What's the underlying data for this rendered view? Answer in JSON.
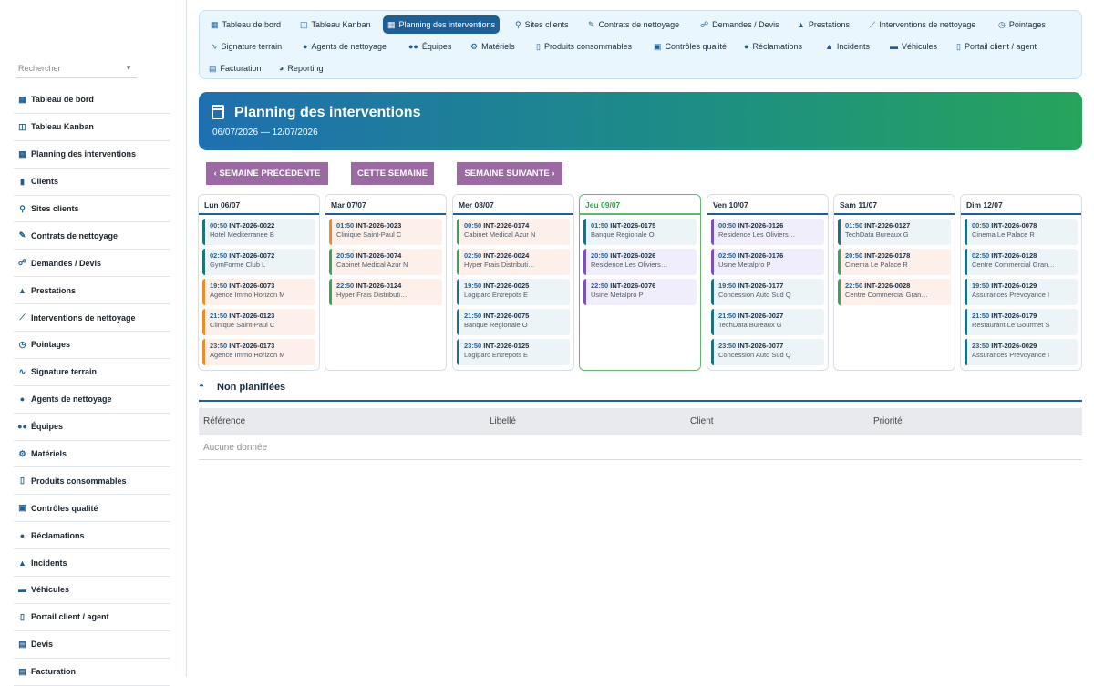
{
  "sidebar": {
    "search_placeholder": "Rechercher",
    "items": [
      {
        "icon": "grid-icon",
        "glyph": "▦",
        "label": "Tableau de bord"
      },
      {
        "icon": "kanban-icon",
        "glyph": "◫",
        "label": "Tableau Kanban"
      },
      {
        "icon": "calendar-icon",
        "glyph": "▦",
        "label": "Planning des interventions"
      },
      {
        "icon": "building-icon",
        "glyph": "▮",
        "label": "Clients"
      },
      {
        "icon": "map-pin-icon",
        "glyph": "⚲",
        "label": "Sites clients"
      },
      {
        "icon": "contract-icon",
        "glyph": "✎",
        "label": "Contrats de nettoyage"
      },
      {
        "icon": "handshake-icon",
        "glyph": "☍",
        "label": "Demandes / Devis"
      },
      {
        "icon": "service-icon",
        "glyph": "▲",
        "label": "Prestations"
      },
      {
        "icon": "broom-icon",
        "glyph": "⟋",
        "label": "Interventions de nettoyage"
      },
      {
        "icon": "clock-icon",
        "glyph": "◷",
        "label": "Pointages"
      },
      {
        "icon": "signature-icon",
        "glyph": "∿",
        "label": "Signature terrain"
      },
      {
        "icon": "user-icon",
        "glyph": "●",
        "label": "Agents de nettoyage"
      },
      {
        "icon": "team-icon",
        "glyph": "●●",
        "label": "Équipes"
      },
      {
        "icon": "cogs-icon",
        "glyph": "⚙",
        "label": "Matériels"
      },
      {
        "icon": "spray-icon",
        "glyph": "▯",
        "label": "Produits consommables"
      },
      {
        "icon": "clipboard-check-icon",
        "glyph": "▣",
        "label": "Contrôles qualité"
      },
      {
        "icon": "comment-icon",
        "glyph": "●",
        "label": "Réclamations"
      },
      {
        "icon": "warning-icon",
        "glyph": "▲",
        "label": "Incidents"
      },
      {
        "icon": "truck-icon",
        "glyph": "▬",
        "label": "Véhicules"
      },
      {
        "icon": "mobile-icon",
        "glyph": "▯",
        "label": "Portail client / agent"
      },
      {
        "icon": "file-icon",
        "glyph": "▤",
        "label": "Devis"
      },
      {
        "icon": "invoice-icon",
        "glyph": "▤",
        "label": "Facturation"
      }
    ]
  },
  "topnav": {
    "items": [
      {
        "icon": "grid-icon",
        "glyph": "▦",
        "label": "Tableau de bord",
        "active": false
      },
      {
        "icon": "kanban-icon",
        "glyph": "◫",
        "label": "Tableau Kanban",
        "active": false
      },
      {
        "icon": "calendar-icon",
        "glyph": "▦",
        "label": "Planning des interventions",
        "active": true
      },
      {
        "icon": "map-pin-icon",
        "glyph": "⚲",
        "label": "Sites clients",
        "active": false
      },
      {
        "icon": "contract-icon",
        "glyph": "✎",
        "label": "Contrats de nettoyage",
        "active": false
      },
      {
        "icon": "handshake-icon",
        "glyph": "☍",
        "label": "Demandes / Devis",
        "active": false
      },
      {
        "icon": "service-icon",
        "glyph": "▲",
        "label": "Prestations",
        "active": false
      },
      {
        "icon": "broom-icon",
        "glyph": "⟋",
        "label": "Interventions de nettoyage",
        "active": false
      },
      {
        "icon": "clock-icon",
        "glyph": "◷",
        "label": "Pointages",
        "active": false
      },
      {
        "icon": "signature-icon",
        "glyph": "∿",
        "label": "Signature terrain",
        "active": false
      },
      {
        "icon": "user-icon",
        "glyph": "●",
        "label": "Agents de nettoyage",
        "active": false
      },
      {
        "icon": "team-icon",
        "glyph": "●●",
        "label": "Équipes",
        "active": false
      },
      {
        "icon": "cogs-icon",
        "glyph": "⚙",
        "label": "Matériels",
        "active": false
      },
      {
        "icon": "spray-icon",
        "glyph": "▯",
        "label": "Produits consommables",
        "active": false
      },
      {
        "icon": "clipboard-check-icon",
        "glyph": "▣",
        "label": "Contrôles qualité",
        "active": false
      },
      {
        "icon": "comment-icon",
        "glyph": "●",
        "label": "Réclamations",
        "active": false
      },
      {
        "icon": "warning-icon",
        "glyph": "▲",
        "label": "Incidents",
        "active": false
      },
      {
        "icon": "truck-icon",
        "glyph": "▬",
        "label": "Véhicules",
        "active": false
      },
      {
        "icon": "mobile-icon",
        "glyph": "▯",
        "label": "Portail client / agent",
        "active": false
      },
      {
        "icon": "invoice-icon",
        "glyph": "▤",
        "label": "Facturation",
        "active": false
      },
      {
        "icon": "chart-pie-icon",
        "glyph": "◕",
        "label": "Reporting",
        "active": false
      }
    ]
  },
  "header": {
    "title": "Planning des interventions",
    "date_range": "06/07/2026 — 12/07/2026"
  },
  "week_nav": {
    "previous": "SEMAINE PRÉCÉDENTE",
    "current": "CETTE SEMAINE",
    "next": "SEMAINE SUIVANTE"
  },
  "days": [
    {
      "label": "Lun 06/07",
      "today": false,
      "items": [
        {
          "time": "00:50",
          "ref": "INT-2026-0022",
          "client": "Hotel Mediterranee B",
          "color": "teal"
        },
        {
          "time": "02:50",
          "ref": "INT-2026-0072",
          "client": "GymForme Club L",
          "color": "teal"
        },
        {
          "time": "19:50",
          "ref": "INT-2026-0073",
          "client": "Agence Immo Horizon M",
          "color": "orange"
        },
        {
          "time": "21:50",
          "ref": "INT-2026-0123",
          "client": "Clinique Saint-Paul C",
          "color": "orange"
        },
        {
          "time": "23:50",
          "ref": "INT-2026-0173",
          "client": "Agence Immo Horizon M",
          "color": "orange"
        }
      ]
    },
    {
      "label": "Mar 07/07",
      "today": false,
      "items": [
        {
          "time": "01:50",
          "ref": "INT-2026-0023",
          "client": "Clinique Saint-Paul C",
          "color": "orange"
        },
        {
          "time": "20:50",
          "ref": "INT-2026-0074",
          "client": "Cabinet Medical Azur N",
          "color": "green"
        },
        {
          "time": "22:50",
          "ref": "INT-2026-0124",
          "client": "Hyper Frais Distributi…",
          "color": "green"
        }
      ]
    },
    {
      "label": "Mer 08/07",
      "today": false,
      "items": [
        {
          "time": "00:50",
          "ref": "INT-2026-0174",
          "client": "Cabinet Medical Azur N",
          "color": "green"
        },
        {
          "time": "02:50",
          "ref": "INT-2026-0024",
          "client": "Hyper Frais Distributi…",
          "color": "green"
        },
        {
          "time": "19:50",
          "ref": "INT-2026-0025",
          "client": "Logiparc Entrepots E",
          "color": "teal"
        },
        {
          "time": "21:50",
          "ref": "INT-2026-0075",
          "client": "Banque Regionale O",
          "color": "teal"
        },
        {
          "time": "23:50",
          "ref": "INT-2026-0125",
          "client": "Logiparc Entrepots E",
          "color": "teal"
        }
      ]
    },
    {
      "label": "Jeu 09/07",
      "today": true,
      "items": [
        {
          "time": "01:50",
          "ref": "INT-2026-0175",
          "client": "Banque Regionale O",
          "color": "teal"
        },
        {
          "time": "20:50",
          "ref": "INT-2026-0026",
          "client": "Residence Les Oliviers…",
          "color": "purple"
        },
        {
          "time": "22:50",
          "ref": "INT-2026-0076",
          "client": "Usine Metalpro P",
          "color": "purple"
        }
      ]
    },
    {
      "label": "Ven 10/07",
      "today": false,
      "items": [
        {
          "time": "00:50",
          "ref": "INT-2026-0126",
          "client": "Residence Les Oliviers…",
          "color": "purple"
        },
        {
          "time": "02:50",
          "ref": "INT-2026-0176",
          "client": "Usine Metalpro P",
          "color": "purple"
        },
        {
          "time": "19:50",
          "ref": "INT-2026-0177",
          "client": "Concession Auto Sud Q",
          "color": "teal"
        },
        {
          "time": "21:50",
          "ref": "INT-2026-0027",
          "client": "TechData Bureaux G",
          "color": "teal"
        },
        {
          "time": "23:50",
          "ref": "INT-2026-0077",
          "client": "Concession Auto Sud Q",
          "color": "teal"
        }
      ]
    },
    {
      "label": "Sam 11/07",
      "today": false,
      "items": [
        {
          "time": "01:50",
          "ref": "INT-2026-0127",
          "client": "TechData Bureaux G",
          "color": "teal"
        },
        {
          "time": "20:50",
          "ref": "INT-2026-0178",
          "client": "Cinema Le Palace R",
          "color": "green"
        },
        {
          "time": "22:50",
          "ref": "INT-2026-0028",
          "client": "Centre Commercial Gran…",
          "color": "green"
        }
      ]
    },
    {
      "label": "Dim 12/07",
      "today": false,
      "items": [
        {
          "time": "00:50",
          "ref": "INT-2026-0078",
          "client": "Cinema Le Palace R",
          "color": "teal"
        },
        {
          "time": "02:50",
          "ref": "INT-2026-0128",
          "client": "Centre Commercial Gran…",
          "color": "teal"
        },
        {
          "time": "19:50",
          "ref": "INT-2026-0129",
          "client": "Assurances Prevoyance I",
          "color": "teal"
        },
        {
          "time": "21:50",
          "ref": "INT-2026-0179",
          "client": "Restaurant Le Gourmet S",
          "color": "teal"
        },
        {
          "time": "23:50",
          "ref": "INT-2026-0029",
          "client": "Assurances Prevoyance I",
          "color": "teal"
        }
      ]
    }
  ],
  "unplanned": {
    "title": "Non planifiées",
    "columns": [
      "Référence",
      "Libellé",
      "Client",
      "Priorité"
    ],
    "empty_text": "Aucune donnée"
  }
}
